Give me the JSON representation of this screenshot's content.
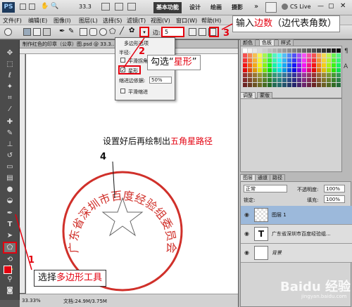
{
  "menubar": {
    "logo": "PS",
    "items": [
      "文件(F)",
      "编辑(E)",
      "图像(I)",
      "图层(L)",
      "选择(S)",
      "滤镜(T)",
      "视图(V)",
      "窗口(W)",
      "帮助(H)"
    ],
    "zoom_value": "33.3",
    "workspaces": [
      "基本功能",
      "设计",
      "绘画",
      "摄影"
    ],
    "cslive": "CS Live"
  },
  "options_bar": {
    "sides_label": "边:",
    "sides_value": "5"
  },
  "popup": {
    "title": "多边形选项",
    "radius_label": "半径:",
    "smooth_corners": "平滑拐角",
    "star": "星形",
    "star_checked": true,
    "indent_label": "缩进边依据:",
    "indent_value": "50%",
    "smooth_indents": "平滑缩进"
  },
  "document": {
    "tab_title": "制作红色的印章（公章）图.psd @ 33.3...",
    "zoom": "33.33%",
    "doc_size": "文档:24.9M/3.75M",
    "stamp_text": "广东省深圳市百度经验组委员会"
  },
  "panels": {
    "swatch_tabs": [
      "颜色",
      "色板",
      "样式"
    ],
    "adj_tabs": [
      "调整",
      "蒙版"
    ],
    "layers_tabs": [
      "图层",
      "通道",
      "路径"
    ],
    "blend_mode": "正常",
    "opacity_label": "不透明度:",
    "opacity_value": "100%",
    "lock_label": "锁定:",
    "fill_label": "填充:",
    "fill_value": "100%",
    "layers": [
      {
        "name": "图层 1",
        "selected": true
      },
      {
        "name": "广东省深圳市百度经验组...",
        "selected": false,
        "type": "T"
      },
      {
        "name": "背景",
        "selected": false
      }
    ]
  },
  "annotations": {
    "step1_num": "1",
    "step1_pre": "选择",
    "step1_hl": "多边形工具",
    "step2_num": "2",
    "step2_pre": "勾选“",
    "step2_hl": "星形",
    "step2_post": "”",
    "step3_num": "3",
    "step3_pre": "输入",
    "step3_hl": "边数",
    "step3_post": "（边代表角数）",
    "step4_num": "4",
    "step4_pre": "设置好后再绘制出",
    "step4_hl": "五角星路径"
  },
  "watermark": "Baidu 经验",
  "watermark_url": "jingyan.baidu.com",
  "colors": {
    "annotation_red": "#e3000f",
    "stamp_red": "#d0302a",
    "foreground_swatch": "#e3000f"
  }
}
